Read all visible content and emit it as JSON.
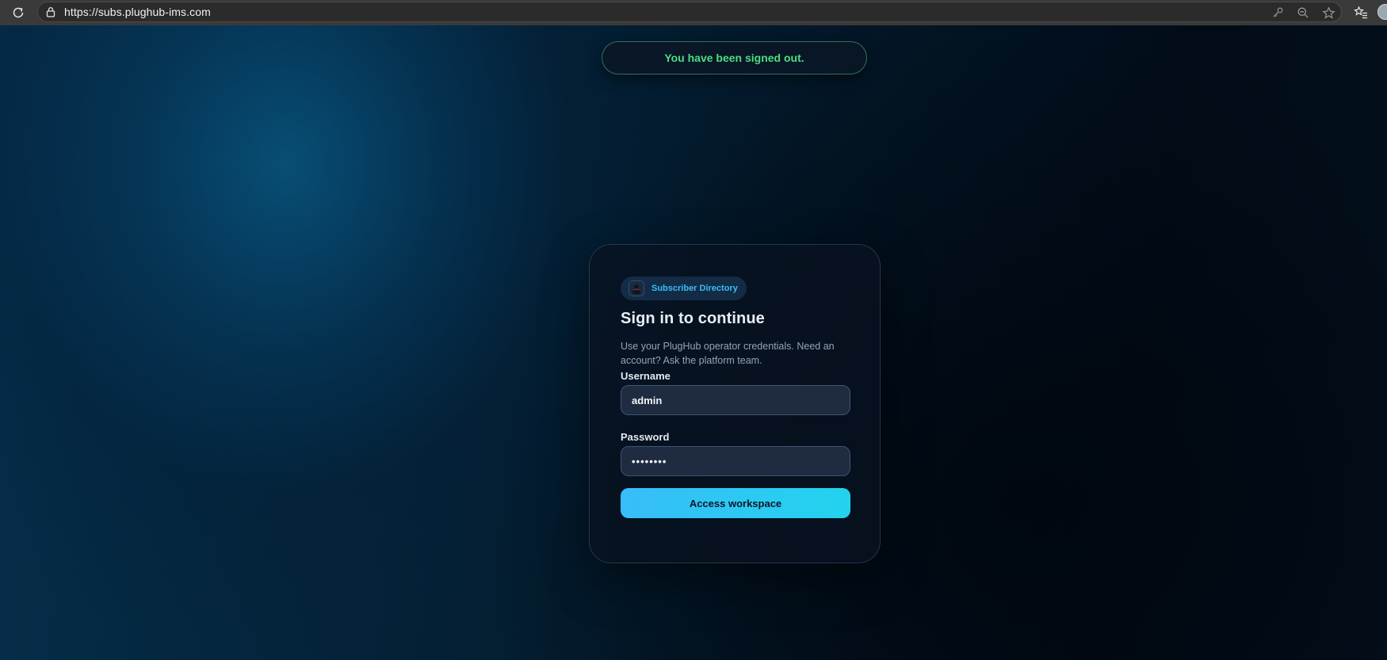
{
  "browser": {
    "url": "https://subs.plughub-ims.com",
    "icons": {
      "reload": "reload-icon",
      "lock": "lock-icon",
      "key": "key-icon",
      "zoom": "zoom-out-icon",
      "star": "star-icon",
      "favorites": "favorites-icon",
      "profile": "profile-avatar"
    }
  },
  "toast": {
    "message": "You have been signed out.",
    "color": "#4ade80"
  },
  "login": {
    "badge_label": "Subscriber Directory",
    "title": "Sign in to continue",
    "description": "Use your PlugHub operator credentials. Need an account? Ask the platform team.",
    "username_label": "Username",
    "username_value": "admin",
    "password_label": "Password",
    "password_value": "password",
    "submit_label": "Access workspace"
  },
  "colors": {
    "accent": "#38bdf8",
    "accent_secondary": "#22d3ee",
    "success": "#4ade80",
    "card_bg": "#0b1626"
  }
}
